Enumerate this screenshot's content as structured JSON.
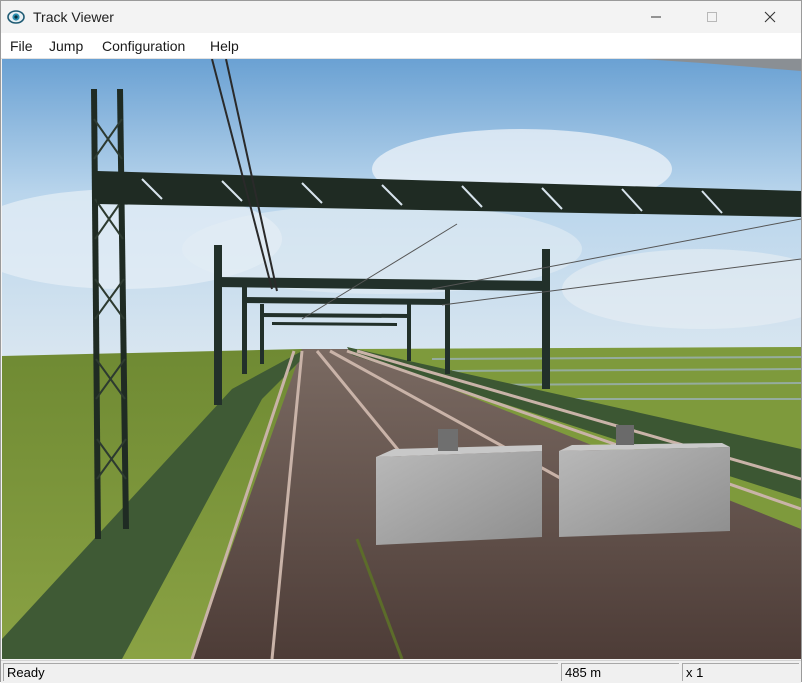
{
  "window": {
    "title": "Track Viewer",
    "icon": "eye-icon",
    "controls": [
      "minimize-icon",
      "maximize-icon",
      "close-icon"
    ]
  },
  "menu": {
    "items": [
      {
        "label": "File"
      },
      {
        "label": "Jump"
      },
      {
        "label": "Configuration"
      },
      {
        "label": "Help"
      }
    ]
  },
  "viewport": {
    "description": "3D railway track view with overhead catenary gantries, green fencing and concrete blocks"
  },
  "status": {
    "message": "Ready",
    "distance": "485 m",
    "speed": "x 1"
  },
  "colors": {
    "sky_top": "#6fa3d2",
    "grass": "#7f9a3a",
    "track_bed": "#5a4a44",
    "fence": "#3f5a35",
    "gantry": "#1f2b23"
  }
}
